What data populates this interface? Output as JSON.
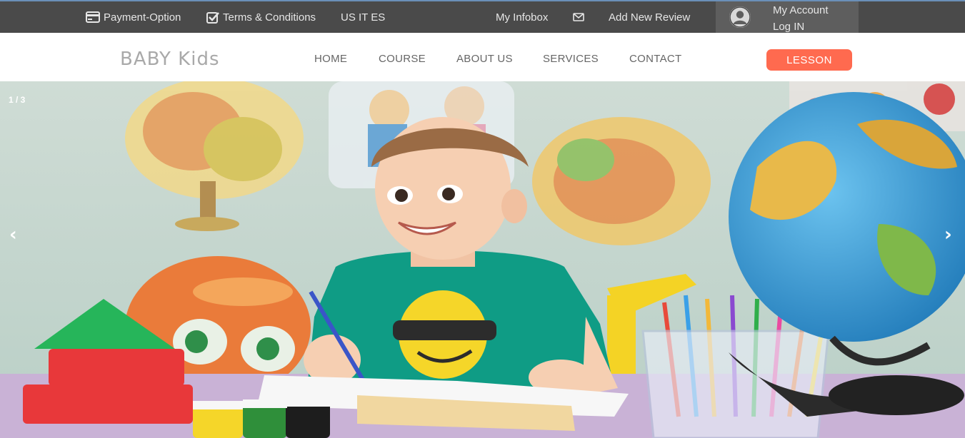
{
  "topbar": {
    "payment_label": "Payment-Option",
    "terms_label": "Terms & Conditions",
    "languages": "US IT ES",
    "infobox_label": "My Infobox",
    "review_label": "Add New Review",
    "account_label": "My Account",
    "login_label": "Log IN"
  },
  "nav": {
    "logo": "BABY Kids",
    "items": [
      "HOME",
      "COURSE",
      "ABOUT US",
      "SERVICES",
      "CONTACT"
    ],
    "cta_label": "LESSON"
  },
  "slider": {
    "counter": "1 / 3",
    "prev_glyph": "‹",
    "next_glyph": "›"
  },
  "colors": {
    "topbar_bg": "#4a4a4a",
    "account_bg": "#5e5e5e",
    "cta_bg": "#ff6a4f",
    "logo_text": "#a9a9a9",
    "nav_text": "#666666"
  },
  "icons": {
    "payment": "credit-card-icon",
    "terms": "checkbox-icon",
    "mail": "envelope-icon",
    "account": "user-avatar-icon"
  }
}
